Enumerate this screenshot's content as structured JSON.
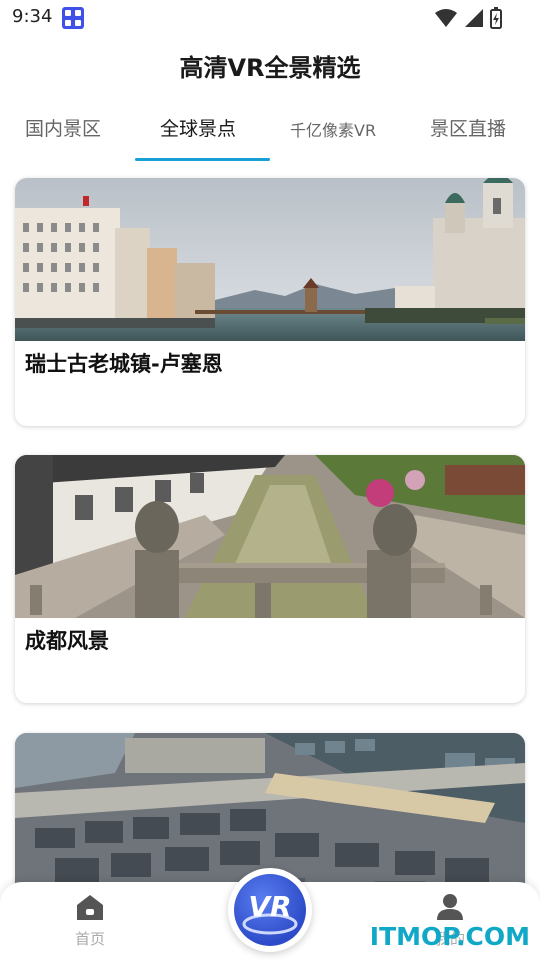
{
  "status_bar": {
    "time": "9:34"
  },
  "header": {
    "title": "高清VR全景精选"
  },
  "tabs": [
    {
      "label": "国内景区",
      "active": false
    },
    {
      "label": "全球景点",
      "active": true
    },
    {
      "label": "千亿像素VR",
      "active": false
    },
    {
      "label": "景区直播",
      "active": false
    }
  ],
  "cards": [
    {
      "title": "瑞士古老城镇-卢塞恩"
    },
    {
      "title": "成都风景"
    },
    {
      "title": ""
    }
  ],
  "bottom_nav": {
    "home_label": "首页",
    "center_label": "VR",
    "mine_label": "我的"
  },
  "watermark": "ITMOP.COM",
  "colors": {
    "accent": "#18a0d6",
    "vr_button": "#2d4bc8",
    "watermark": "#11a8c8"
  }
}
